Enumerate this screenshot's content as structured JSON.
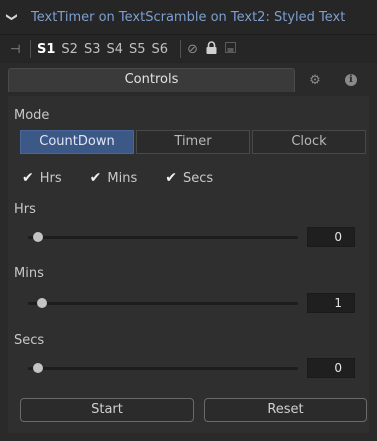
{
  "header": {
    "collapse_glyph": "❯",
    "title": "TextTimer on TextScramble on Text2: Styled Text",
    "pin_glyph": "⊣",
    "slots": [
      "S1",
      "S2",
      "S3",
      "S4",
      "S5",
      "S6"
    ],
    "active_slot": "S1",
    "no_glyph": "⊘",
    "lock_glyph": "🔒",
    "save_glyph": "▭"
  },
  "tabs": {
    "controls_label": "Controls",
    "settings_glyph": "⚙",
    "info_glyph": "ℹ"
  },
  "mode": {
    "label": "Mode",
    "options": [
      "CountDown",
      "Timer",
      "Clock"
    ],
    "selected": "CountDown"
  },
  "toggles": {
    "check_glyph": "✔",
    "items": [
      {
        "label": "Hrs",
        "checked": true
      },
      {
        "label": "Mins",
        "checked": true
      },
      {
        "label": "Secs",
        "checked": true
      }
    ]
  },
  "sliders": {
    "hrs": {
      "label": "Hrs",
      "value": "0",
      "fraction": 0.0
    },
    "mins": {
      "label": "Mins",
      "value": "1",
      "fraction": 0.017
    },
    "secs": {
      "label": "Secs",
      "value": "0",
      "fraction": 0.0
    }
  },
  "actions": {
    "start_label": "Start",
    "reset_label": "Reset"
  },
  "colors": {
    "accent": "#3c5887",
    "title_text": "#7d9fd0"
  }
}
